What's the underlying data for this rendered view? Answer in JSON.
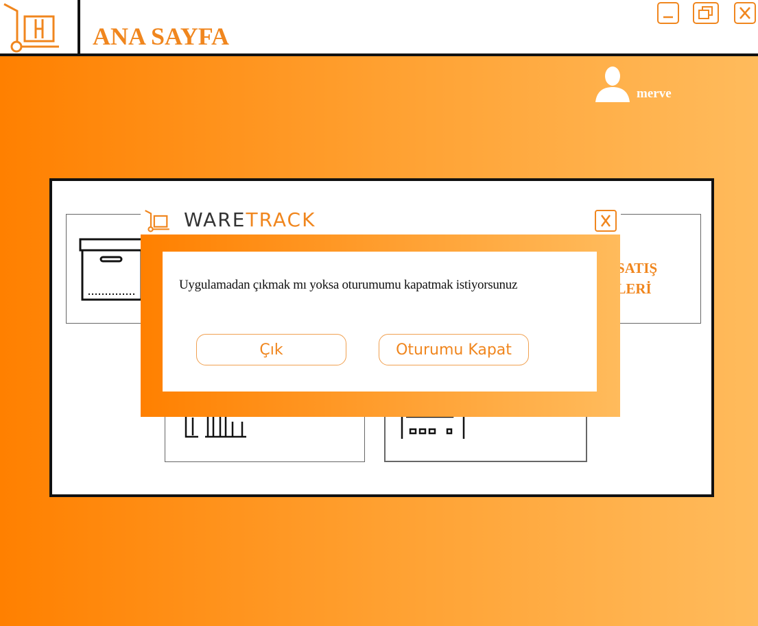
{
  "header": {
    "title": "ANA SAYFA",
    "logo_icon": "hand-truck-icon",
    "window_controls": [
      "minimize-icon",
      "restore-icon",
      "close-icon"
    ]
  },
  "user": {
    "name": "merve",
    "icon": "user-icon"
  },
  "cards": [
    {
      "label_line1": "SATIŞ",
      "label_line2": "LİYELERİ"
    }
  ],
  "dialog": {
    "brand_a": "WARE",
    "brand_b": "TRACK",
    "message": "Uygulamadan çıkmak mı yoksa oturumumu kapatmak istiyorsunuz",
    "exit_label": "Çık",
    "logout_label": "Oturumu Kapat"
  },
  "colors": {
    "accent": "#f0861e",
    "gradient_start": "#ff8000",
    "gradient_end": "#ffbb5c"
  }
}
